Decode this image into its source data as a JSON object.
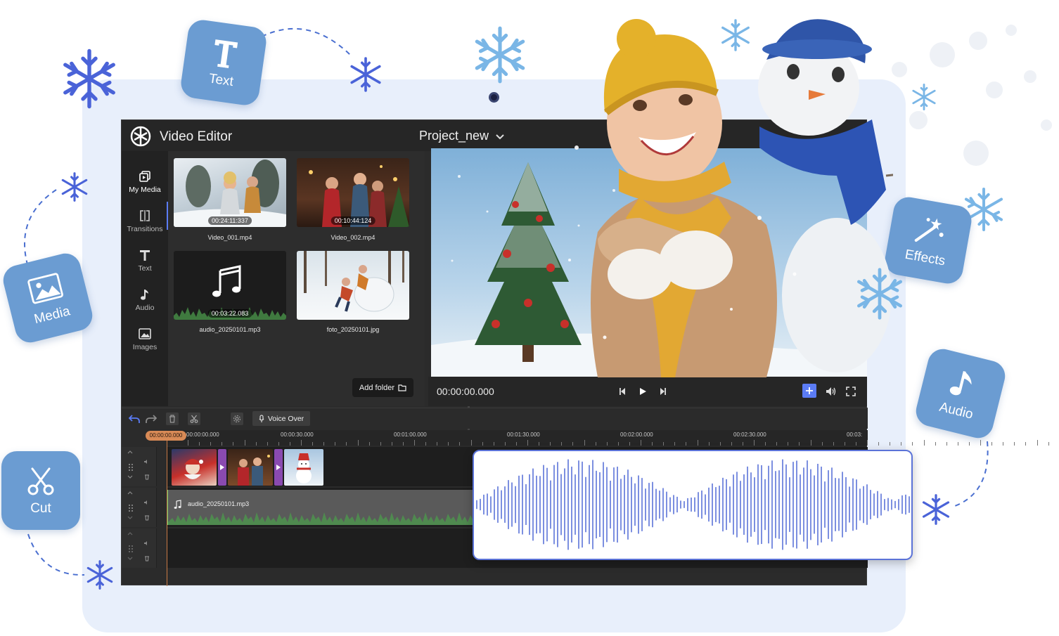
{
  "app": {
    "title": "Video Editor",
    "project_name": "Project_new"
  },
  "feature_tiles": {
    "text": "Text",
    "media": "Media",
    "effects": "Effects",
    "audio": "Audio",
    "cut": "Cut"
  },
  "sidebar": {
    "items": [
      {
        "label": "My Media",
        "icon": "media-stack-icon"
      },
      {
        "label": "Transitions",
        "icon": "transitions-icon"
      },
      {
        "label": "Text",
        "icon": "text-icon"
      },
      {
        "label": "Audio",
        "icon": "music-note-icon"
      },
      {
        "label": "Images",
        "icon": "image-icon"
      }
    ]
  },
  "media": {
    "items": [
      {
        "name": "Video_001.mp4",
        "duration": "00:24:11:337"
      },
      {
        "name": "Video_002.mp4",
        "duration": "00:10:44:124"
      },
      {
        "name": "audio_20250101.mp3",
        "duration": "00:03:22.083"
      },
      {
        "name": "foto_20250101.jpg",
        "duration": ""
      }
    ],
    "add_folder_label": "Add folder"
  },
  "player": {
    "timecode": "00:00:00.000"
  },
  "timeline": {
    "voice_over_label": "Voice Over",
    "playhead_time": "00:00:00.000",
    "ruler_labels": [
      "00:00:00.000",
      "00:00:30.000",
      "00:01:00.000",
      "00:01:30.000",
      "00:02:00.000",
      "00:02:30.000",
      "00:03:"
    ],
    "audio_clip_name": "audio_20250101.mp3"
  },
  "colors": {
    "accent": "#5b7cf5",
    "tile": "#6b9cd2",
    "transition": "#8a4ab0",
    "waveform": "#5b73d8",
    "backdrop": "#e8effb"
  }
}
